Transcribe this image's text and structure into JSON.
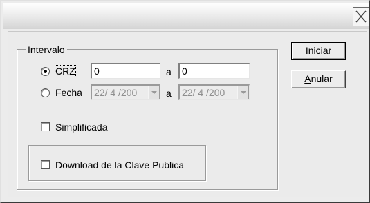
{
  "window": {
    "title": ""
  },
  "titlebar": {
    "close_icon": "close-x-icon"
  },
  "group": {
    "label": "Intervalo"
  },
  "range": {
    "crz": {
      "label": "CRZ",
      "selected": true,
      "from": "0",
      "separator": "a",
      "to": "0"
    },
    "fecha": {
      "label": "Fecha",
      "selected": false,
      "from": "22/ 4 /200",
      "separator": "a",
      "to": "22/ 4 /200"
    }
  },
  "options": {
    "simplificada": {
      "label": "Simplificada",
      "checked": false
    },
    "download_clave": {
      "label": "Download de la Clave Publica",
      "checked": false
    }
  },
  "buttons": {
    "iniciar": {
      "label_underlined": "I",
      "label_rest": "niciar"
    },
    "anular": {
      "label_underlined": "A",
      "label_rest": "nular"
    }
  }
}
